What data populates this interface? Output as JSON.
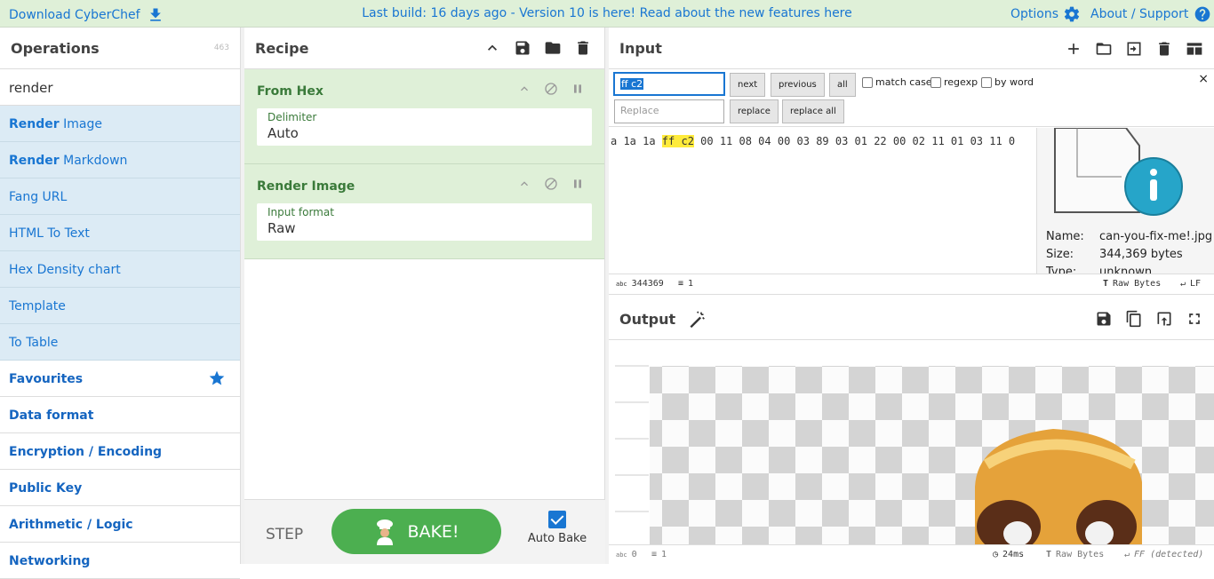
{
  "banner": {
    "download": "Download CyberChef",
    "message": "Last build: 16 days ago - Version 10 is here! Read about the new features here",
    "options": "Options",
    "about": "About / Support"
  },
  "operations": {
    "title": "Operations",
    "count": "463",
    "search": "render",
    "results": [
      {
        "bold": "Render",
        "rest": " Image"
      },
      {
        "bold": "Render",
        "rest": " Markdown"
      },
      {
        "bold": "",
        "rest": "Fang URL"
      },
      {
        "bold": "",
        "rest": "HTML To Text"
      },
      {
        "bold": "",
        "rest": "Hex Density chart"
      },
      {
        "bold": "",
        "rest": "Template"
      },
      {
        "bold": "",
        "rest": "To Table"
      }
    ],
    "categories": [
      "Favourites",
      "Data format",
      "Encryption / Encoding",
      "Public Key",
      "Arithmetic / Logic",
      "Networking"
    ]
  },
  "recipe": {
    "title": "Recipe",
    "ops": [
      {
        "name": "From Hex",
        "arg_label": "Delimiter",
        "arg_value": "Auto"
      },
      {
        "name": "Render Image",
        "arg_label": "Input format",
        "arg_value": "Raw"
      }
    ],
    "step": "STEP",
    "bake": "BAKE!",
    "autobake": "Auto Bake"
  },
  "input": {
    "title": "Input",
    "find_value": "ff c2",
    "replace_placeholder": "Replace",
    "btn_next": "next",
    "btn_previous": "previous",
    "btn_all": "all",
    "opt_match_case": "match case",
    "opt_regexp": "regexp",
    "opt_by_word": "by word",
    "btn_replace": "replace",
    "btn_replace_all": "replace all",
    "hex_pre": "a 1a 1a ",
    "hex_match": "ff c2",
    "hex_post": " 00 11 08 04 00 03 89 03 01 22 00 02 11 01 03 11 0",
    "file_name_label": "Name:",
    "file_name": "can-you-fix-me!.jpg",
    "file_size_label": "Size:",
    "file_size": "344,369 bytes",
    "file_type_label": "Type:",
    "file_type": "unknown",
    "status_length": "344369",
    "status_lines": "1",
    "status_encoding": "Raw Bytes",
    "status_eol": "LF"
  },
  "output": {
    "title": "Output",
    "status_length": "0",
    "status_lines": "1",
    "status_time": "24ms",
    "status_encoding": "Raw Bytes",
    "status_eol": "FF (detected)"
  }
}
